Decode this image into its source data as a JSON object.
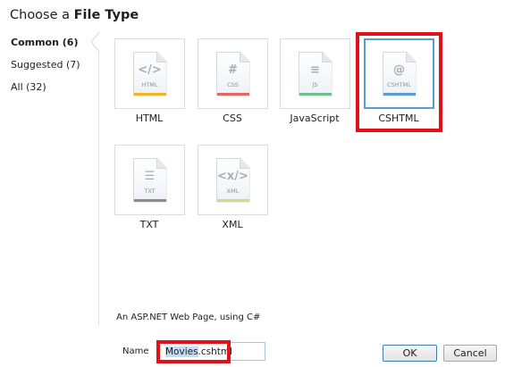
{
  "title": {
    "prefix": "Choose a",
    "bold": "File Type"
  },
  "categories": [
    {
      "label": "Common (6)",
      "selected": true
    },
    {
      "label": "Suggested (7)"
    },
    {
      "label": "All (32)"
    }
  ],
  "file_types": [
    {
      "label": "HTML",
      "icon_text": "HTML",
      "glyph": "</>",
      "color": "#f0b429"
    },
    {
      "label": "CSS",
      "icon_text": "CSS",
      "glyph": "#",
      "color": "#e06666"
    },
    {
      "label": "JavaScript",
      "icon_text": "JS",
      "glyph": "≡",
      "color": "#6cc08b"
    },
    {
      "label": "CSHTML",
      "icon_text": "CSHTML",
      "glyph": "@",
      "color": "#5b9bd5",
      "selected": true
    },
    {
      "label": "TXT",
      "icon_text": "TXT",
      "glyph": "☰",
      "color": "#8c8c8c"
    },
    {
      "label": "XML",
      "icon_text": "XML",
      "glyph": "<x/>",
      "color": "#d9d87a"
    }
  ],
  "description": "An ASP.NET Web Page, using C#",
  "name_field": {
    "label": "Name",
    "value_selected": "Movies",
    "value_rest": ".cshtml"
  },
  "buttons": {
    "ok": "OK",
    "cancel": "Cancel"
  },
  "highlight_color": "#e3101a"
}
